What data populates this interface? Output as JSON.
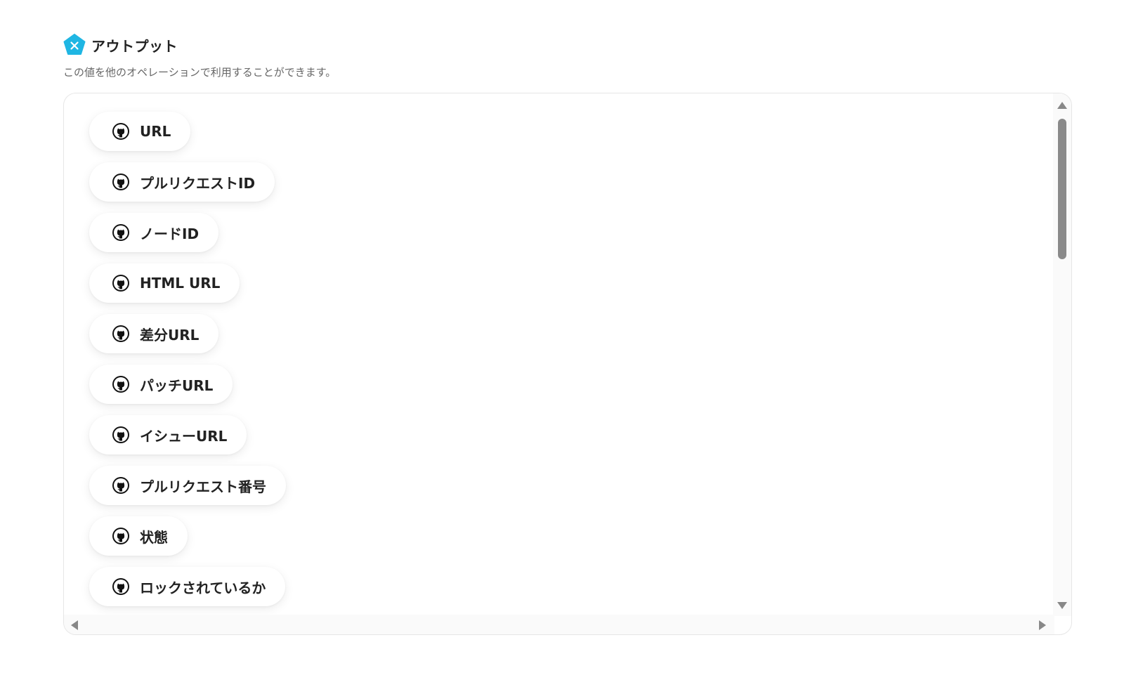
{
  "section": {
    "title": "アウトプット",
    "description": "この値を他のオペレーションで利用することができます。",
    "icon": "yoom-x-badge-icon",
    "accent_color": "#1fb6e3"
  },
  "outputs": [
    {
      "label": "URL",
      "icon": "github-icon"
    },
    {
      "label": "プルリクエストID",
      "icon": "github-icon"
    },
    {
      "label": "ノードID",
      "icon": "github-icon"
    },
    {
      "label": "HTML URL",
      "icon": "github-icon"
    },
    {
      "label": "差分URL",
      "icon": "github-icon"
    },
    {
      "label": "パッチURL",
      "icon": "github-icon"
    },
    {
      "label": "イシューURL",
      "icon": "github-icon"
    },
    {
      "label": "プルリクエスト番号",
      "icon": "github-icon"
    },
    {
      "label": "状態",
      "icon": "github-icon"
    },
    {
      "label": "ロックされているか",
      "icon": "github-icon"
    }
  ]
}
